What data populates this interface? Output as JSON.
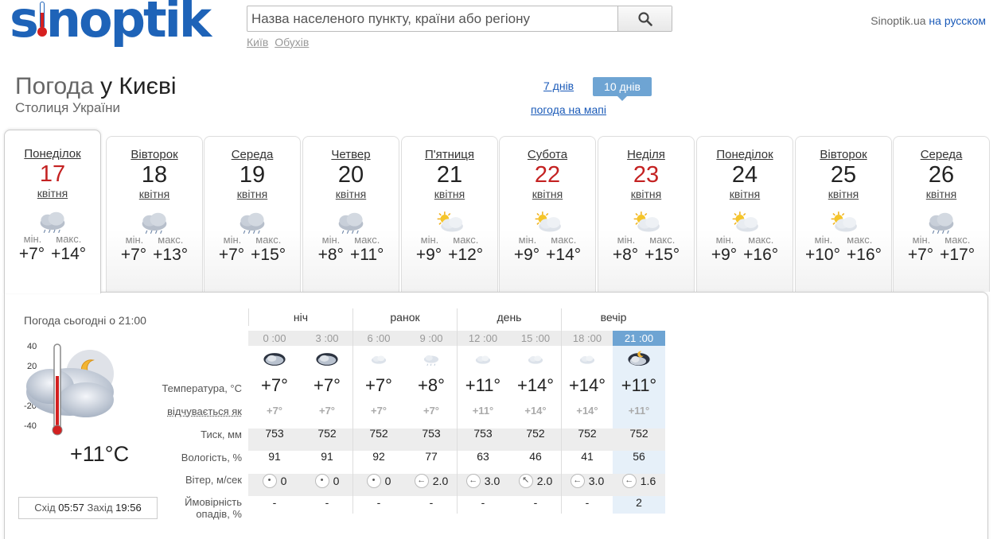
{
  "header": {
    "logo_pre": "s",
    "logo_post": "noptik",
    "search_placeholder": "Назва населеного пункту, країни або регіону",
    "quick_links": [
      "Київ",
      "Обухів"
    ],
    "site_name": "Sinoptik.ua",
    "lang_link": "на русском"
  },
  "title": {
    "prefix": "Погода",
    "city": "у Києві",
    "subtitle": "Столиця України"
  },
  "range": {
    "seven": "7 днів",
    "ten": "10 днів",
    "map": "погода на мапі"
  },
  "days": [
    {
      "name": "Понеділок",
      "num": "17",
      "month": "квітня",
      "icon": "cloudy-rain-icon",
      "weekend": true,
      "min": "+7°",
      "max": "+14°"
    },
    {
      "name": "Вівторок",
      "num": "18",
      "month": "квітня",
      "icon": "cloudy-rain-icon",
      "weekend": false,
      "min": "+7°",
      "max": "+13°"
    },
    {
      "name": "Середа",
      "num": "19",
      "month": "квітня",
      "icon": "cloudy-rain-icon",
      "weekend": false,
      "min": "+7°",
      "max": "+15°"
    },
    {
      "name": "Четвер",
      "num": "20",
      "month": "квітня",
      "icon": "cloudy-rain-icon",
      "weekend": false,
      "min": "+8°",
      "max": "+11°"
    },
    {
      "name": "П'ятниця",
      "num": "21",
      "month": "квітня",
      "icon": "partly-sunny-icon",
      "weekend": false,
      "min": "+9°",
      "max": "+12°"
    },
    {
      "name": "Субота",
      "num": "22",
      "month": "квітня",
      "icon": "partly-sunny-icon",
      "weekend": true,
      "min": "+9°",
      "max": "+14°"
    },
    {
      "name": "Неділя",
      "num": "23",
      "month": "квітня",
      "icon": "partly-sunny-icon",
      "weekend": true,
      "min": "+8°",
      "max": "+15°"
    },
    {
      "name": "Понеділок",
      "num": "24",
      "month": "квітня",
      "icon": "partly-sunny-icon",
      "weekend": false,
      "min": "+9°",
      "max": "+16°"
    },
    {
      "name": "Вівторок",
      "num": "25",
      "month": "квітня",
      "icon": "partly-sunny-icon",
      "weekend": false,
      "min": "+10°",
      "max": "+16°"
    },
    {
      "name": "Середа",
      "num": "26",
      "month": "квітня",
      "icon": "cloudy-rain-icon",
      "weekend": false,
      "min": "+7°",
      "max": "+17°"
    }
  ],
  "min_label": "мін.",
  "max_label": "макс.",
  "now": {
    "label": "Погода сьогодні о 21:00",
    "temp": "+11°C",
    "scale": [
      "40",
      "20",
      "0",
      "-20",
      "-40"
    ],
    "sunrise_label": "Схід",
    "sunrise": "05:57",
    "sunset_label": "Захід",
    "sunset": "19:56"
  },
  "periods": [
    "ніч",
    "ранок",
    "день",
    "вечір"
  ],
  "row_labels": {
    "temp": "Температура, °C",
    "feel": "відчувається як",
    "pressure": "Тиск, мм",
    "humidity": "Вологість, %",
    "wind": "Вітер, м/сек",
    "precip1": "Ймовірність",
    "precip2": "опадів, %"
  },
  "hours": [
    {
      "time": "0 :00",
      "icon": "cloudy-night-icon",
      "temp": "+7°",
      "feel": "+7°",
      "pressure": "753",
      "humidity": "91",
      "wind_dir": "calm",
      "wind": "0",
      "precip": "-"
    },
    {
      "time": "3 :00",
      "icon": "cloudy-night-icon",
      "temp": "+7°",
      "feel": "+7°",
      "pressure": "752",
      "humidity": "91",
      "wind_dir": "calm",
      "wind": "0",
      "precip": "-"
    },
    {
      "time": "6 :00",
      "icon": "light-cloud-icon",
      "temp": "+7°",
      "feel": "+7°",
      "pressure": "752",
      "humidity": "92",
      "wind_dir": "calm",
      "wind": "0",
      "precip": "-"
    },
    {
      "time": "9 :00",
      "icon": "light-rain-icon",
      "temp": "+8°",
      "feel": "+7°",
      "pressure": "753",
      "humidity": "77",
      "wind_dir": "←",
      "wind": "2.0",
      "precip": "-"
    },
    {
      "time": "12 :00",
      "icon": "light-cloud-icon",
      "temp": "+11°",
      "feel": "+11°",
      "pressure": "753",
      "humidity": "63",
      "wind_dir": "←",
      "wind": "3.0",
      "precip": "-"
    },
    {
      "time": "15 :00",
      "icon": "light-cloud-icon",
      "temp": "+14°",
      "feel": "+14°",
      "pressure": "752",
      "humidity": "46",
      "wind_dir": "↖",
      "wind": "2.0",
      "precip": "-"
    },
    {
      "time": "18 :00",
      "icon": "light-cloud-icon",
      "temp": "+14°",
      "feel": "+14°",
      "pressure": "752",
      "humidity": "41",
      "wind_dir": "←",
      "wind": "3.0",
      "precip": "-"
    },
    {
      "time": "21 :00",
      "icon": "cloudy-moon-icon",
      "temp": "+11°",
      "feel": "+11°",
      "pressure": "752",
      "humidity": "56",
      "wind_dir": "←",
      "wind": "1.6",
      "precip": "2"
    }
  ],
  "colors": {
    "brand": "#1e63b8",
    "accent": "#6ea4d3",
    "weekend": "#c42222"
  }
}
